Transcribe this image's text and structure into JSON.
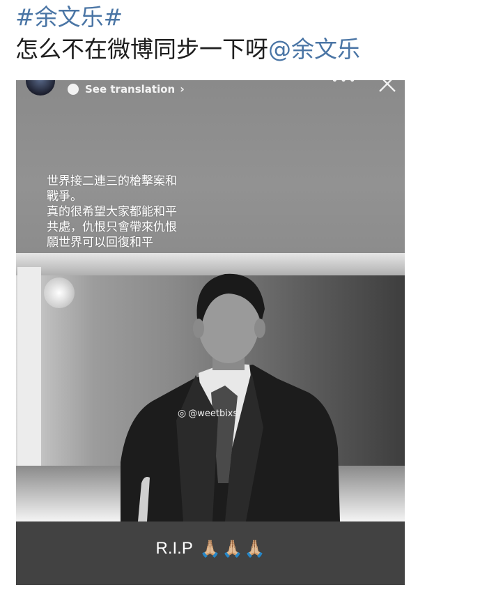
{
  "post": {
    "hashtag": "#余文乐#",
    "body_text": "怎么不在微博同步一下呀",
    "mention": "@余文乐"
  },
  "story": {
    "translate_label": "See translation",
    "translate_chevron": "›",
    "more_icon": "more-dots-icon",
    "close_icon": "close-icon",
    "caption": "世界接二連三的槍擊案和\n戰爭。\n真的很希望大家都能和平\n共處，仇恨只會帶來仇恨\n願世界可以回復和平",
    "watermark": "@weetbixs",
    "watermark_icon": "weibo-icon",
    "footer_text": "R.I.P",
    "emoji": [
      "🙏🏼",
      "🙏🏼",
      "🙏🏼"
    ]
  }
}
